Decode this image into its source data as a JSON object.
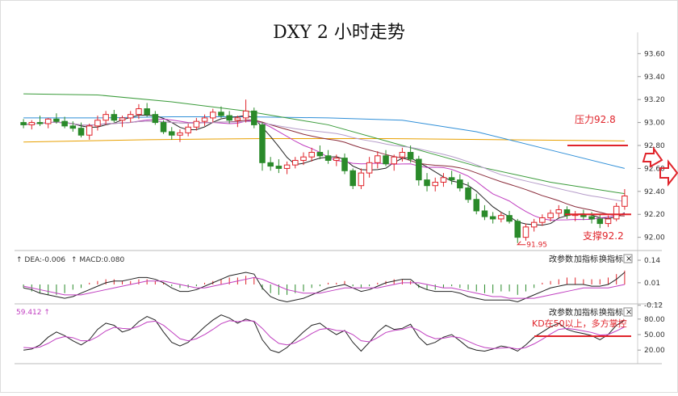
{
  "title": "DXY 2 小时走势",
  "chart_data": {
    "type": "candlestick",
    "title": "DXY 2 小时走势",
    "main": {
      "ylim": [
        91.92,
        93.68
      ],
      "yticks": [
        "93.60",
        "93.40",
        "93.20",
        "93.00",
        "92.80",
        "92.60",
        "92.40",
        "92.20",
        "92.00"
      ],
      "candles": [
        [
          93.0,
          93.03,
          92.95,
          92.98
        ],
        [
          92.98,
          93.02,
          92.94,
          93.0
        ],
        [
          93.0,
          93.06,
          92.97,
          92.99
        ],
        [
          92.99,
          93.04,
          92.95,
          93.03
        ],
        [
          93.03,
          93.08,
          92.99,
          93.01
        ],
        [
          93.01,
          93.05,
          92.95,
          92.97
        ],
        [
          92.97,
          93.01,
          92.92,
          92.95
        ],
        [
          92.95,
          93.0,
          92.87,
          92.89
        ],
        [
          92.89,
          92.99,
          92.85,
          92.97
        ],
        [
          92.97,
          93.06,
          92.93,
          93.02
        ],
        [
          93.02,
          93.1,
          92.98,
          93.07
        ],
        [
          93.07,
          93.11,
          93.0,
          93.02
        ],
        [
          93.02,
          93.06,
          92.96,
          93.04
        ],
        [
          93.04,
          93.1,
          93.0,
          93.07
        ],
        [
          93.07,
          93.16,
          93.03,
          93.12
        ],
        [
          93.12,
          93.17,
          93.05,
          93.07
        ],
        [
          93.07,
          93.1,
          92.98,
          93.0
        ],
        [
          93.0,
          93.02,
          92.9,
          92.92
        ],
        [
          92.92,
          92.96,
          92.85,
          92.89
        ],
        [
          92.89,
          92.94,
          92.83,
          92.91
        ],
        [
          92.91,
          92.99,
          92.88,
          92.96
        ],
        [
          92.96,
          93.04,
          92.93,
          93.01
        ],
        [
          93.01,
          93.07,
          92.97,
          93.04
        ],
        [
          93.04,
          93.12,
          93.0,
          93.09
        ],
        [
          93.09,
          93.14,
          93.04,
          93.06
        ],
        [
          93.06,
          93.1,
          92.99,
          93.02
        ],
        [
          93.02,
          93.06,
          92.96,
          93.04
        ],
        [
          93.04,
          93.2,
          93.0,
          93.1
        ],
        [
          93.1,
          93.13,
          92.95,
          92.98
        ],
        [
          92.98,
          93.0,
          92.58,
          92.65
        ],
        [
          92.65,
          92.7,
          92.58,
          92.62
        ],
        [
          92.62,
          92.68,
          92.56,
          92.6
        ],
        [
          92.6,
          92.66,
          92.55,
          92.63
        ],
        [
          92.63,
          92.7,
          92.6,
          92.67
        ],
        [
          92.67,
          92.74,
          92.63,
          92.7
        ],
        [
          92.7,
          92.78,
          92.66,
          92.74
        ],
        [
          92.74,
          92.8,
          92.68,
          92.71
        ],
        [
          92.71,
          92.76,
          92.64,
          92.67
        ],
        [
          92.67,
          92.72,
          92.62,
          92.69
        ],
        [
          92.69,
          92.73,
          92.55,
          92.58
        ],
        [
          92.58,
          92.6,
          92.42,
          92.45
        ],
        [
          92.45,
          92.6,
          92.42,
          92.56
        ],
        [
          92.56,
          92.7,
          92.52,
          92.65
        ],
        [
          92.65,
          92.75,
          92.6,
          92.71
        ],
        [
          92.71,
          92.76,
          92.62,
          92.64
        ],
        [
          92.64,
          92.72,
          92.58,
          92.7
        ],
        [
          92.7,
          92.78,
          92.66,
          92.74
        ],
        [
          92.74,
          92.8,
          92.65,
          92.68
        ],
        [
          92.68,
          92.71,
          92.45,
          92.5
        ],
        [
          92.5,
          92.56,
          92.4,
          92.45
        ],
        [
          92.45,
          92.52,
          92.4,
          92.48
        ],
        [
          92.48,
          92.56,
          92.44,
          92.52
        ],
        [
          92.52,
          92.58,
          92.46,
          92.5
        ],
        [
          92.5,
          92.55,
          92.4,
          92.43
        ],
        [
          92.43,
          92.48,
          92.3,
          92.33
        ],
        [
          92.33,
          92.38,
          92.2,
          92.23
        ],
        [
          92.23,
          92.28,
          92.15,
          92.18
        ],
        [
          92.18,
          92.22,
          92.12,
          92.16
        ],
        [
          92.16,
          92.22,
          92.13,
          92.19
        ],
        [
          92.19,
          92.23,
          92.12,
          92.14
        ],
        [
          92.14,
          92.16,
          91.95,
          92.0
        ],
        [
          92.0,
          92.12,
          91.97,
          92.09
        ],
        [
          92.09,
          92.16,
          92.05,
          92.13
        ],
        [
          92.13,
          92.2,
          92.1,
          92.17
        ],
        [
          92.17,
          92.24,
          92.14,
          92.21
        ],
        [
          92.21,
          92.28,
          92.17,
          92.24
        ],
        [
          92.24,
          92.27,
          92.16,
          92.19
        ],
        [
          92.19,
          92.23,
          92.14,
          92.2
        ],
        [
          92.2,
          92.24,
          92.15,
          92.18
        ],
        [
          92.18,
          92.22,
          92.12,
          92.16
        ],
        [
          92.16,
          92.2,
          92.08,
          92.12
        ],
        [
          92.12,
          92.19,
          92.09,
          92.16
        ],
        [
          92.16,
          92.3,
          92.14,
          92.27
        ],
        [
          92.27,
          92.42,
          92.24,
          92.36
        ]
      ],
      "ma_levels": {
        "orange": [
          92.72,
          92.76,
          92.8,
          92.83,
          92.85,
          92.86,
          92.86,
          92.85,
          92.84
        ],
        "blue": [
          93.04,
          93.04,
          93.05,
          93.05,
          93.04,
          93.02,
          92.92,
          92.76,
          92.6
        ],
        "green": [
          93.25,
          93.24,
          93.18,
          93.1,
          92.98,
          92.8,
          92.62,
          92.48,
          92.38
        ]
      }
    },
    "macd": {
      "label": "DEA:-0.006",
      "label2": "MACD:0.080",
      "yticks": [
        "0.14",
        "0.01",
        "-0.12"
      ],
      "histogram": [
        -0.02,
        -0.04,
        -0.05,
        -0.06,
        -0.06,
        -0.05,
        -0.03,
        -0.02,
        0.01,
        0.02,
        0.03,
        0.03,
        0.02,
        0.02,
        0.03,
        0.03,
        0.02,
        0.01,
        -0.01,
        -0.02,
        -0.02,
        -0.01,
        0.01,
        0.02,
        0.03,
        0.04,
        0.04,
        0.05,
        0.04,
        -0.03,
        -0.05,
        -0.06,
        -0.06,
        -0.05,
        -0.04,
        -0.02,
        -0.01,
        0.01,
        0.01,
        0.02,
        -0.01,
        -0.02,
        -0.01,
        0.01,
        0.02,
        0.03,
        0.03,
        0.02,
        -0.02,
        -0.03,
        -0.03,
        -0.02,
        -0.01,
        -0.02,
        -0.03,
        -0.04,
        -0.05,
        -0.05,
        -0.04,
        -0.04,
        -0.06,
        -0.04,
        -0.02,
        0.01,
        0.02,
        0.03,
        0.04,
        0.04,
        0.03,
        0.03,
        0.03,
        0.04,
        0.06,
        0.08
      ],
      "dif": [
        -0.02,
        -0.03,
        -0.05,
        -0.06,
        -0.07,
        -0.08,
        -0.07,
        -0.05,
        -0.03,
        -0.01,
        0.01,
        0.02,
        0.02,
        0.03,
        0.04,
        0.04,
        0.03,
        0.01,
        -0.02,
        -0.04,
        -0.04,
        -0.03,
        -0.01,
        0.01,
        0.03,
        0.05,
        0.06,
        0.07,
        0.06,
        -0.02,
        -0.07,
        -0.09,
        -0.1,
        -0.09,
        -0.08,
        -0.06,
        -0.04,
        -0.02,
        -0.01,
        0.0,
        -0.02,
        -0.04,
        -0.03,
        -0.01,
        0.01,
        0.02,
        0.03,
        0.03,
        -0.01,
        -0.03,
        -0.04,
        -0.04,
        -0.04,
        -0.05,
        -0.07,
        -0.08,
        -0.09,
        -0.09,
        -0.09,
        -0.09,
        -0.1,
        -0.08,
        -0.06,
        -0.04,
        -0.02,
        -0.01,
        0.0,
        0.0,
        0.0,
        -0.01,
        -0.01,
        0.0,
        0.03,
        0.07
      ],
      "dea": [
        -0.01,
        -0.02,
        -0.03,
        -0.04,
        -0.05,
        -0.06,
        -0.06,
        -0.06,
        -0.05,
        -0.04,
        -0.03,
        -0.02,
        -0.01,
        0.0,
        0.01,
        0.02,
        0.02,
        0.02,
        0.01,
        0.0,
        -0.01,
        -0.02,
        -0.02,
        -0.01,
        0.0,
        0.01,
        0.02,
        0.03,
        0.04,
        0.03,
        0.01,
        -0.01,
        -0.03,
        -0.04,
        -0.05,
        -0.05,
        -0.05,
        -0.04,
        -0.03,
        -0.02,
        -0.02,
        -0.02,
        -0.02,
        -0.02,
        -0.01,
        0.0,
        0.01,
        0.01,
        0.01,
        0.0,
        -0.01,
        -0.02,
        -0.02,
        -0.03,
        -0.04,
        -0.05,
        -0.06,
        -0.07,
        -0.07,
        -0.08,
        -0.08,
        -0.08,
        -0.08,
        -0.07,
        -0.06,
        -0.05,
        -0.04,
        -0.03,
        -0.02,
        -0.02,
        -0.02,
        -0.02,
        -0.01,
        0.0
      ]
    },
    "kdj": {
      "label": "59.412",
      "yticks": [
        "80.00",
        "50.00",
        "20.00"
      ],
      "k": [
        20,
        22,
        30,
        45,
        55,
        48,
        38,
        30,
        40,
        60,
        72,
        68,
        55,
        60,
        75,
        85,
        78,
        55,
        35,
        28,
        35,
        50,
        65,
        78,
        88,
        82,
        72,
        80,
        75,
        40,
        20,
        15,
        25,
        40,
        55,
        68,
        72,
        60,
        50,
        58,
        35,
        18,
        35,
        55,
        68,
        60,
        62,
        70,
        45,
        30,
        35,
        45,
        50,
        38,
        25,
        20,
        18,
        22,
        28,
        25,
        18,
        30,
        45,
        55,
        65,
        72,
        60,
        55,
        52,
        48,
        40,
        50,
        68,
        78
      ],
      "d": [
        25,
        24,
        26,
        33,
        42,
        46,
        44,
        38,
        38,
        46,
        57,
        64,
        62,
        61,
        66,
        74,
        76,
        68,
        55,
        42,
        38,
        42,
        50,
        60,
        71,
        77,
        75,
        77,
        76,
        62,
        45,
        33,
        30,
        34,
        42,
        52,
        60,
        62,
        58,
        57,
        50,
        38,
        36,
        44,
        54,
        58,
        60,
        65,
        58,
        48,
        42,
        43,
        46,
        44,
        37,
        30,
        25,
        23,
        24,
        25,
        22,
        25,
        32,
        41,
        51,
        60,
        62,
        60,
        57,
        54,
        49,
        50,
        57,
        65
      ]
    }
  },
  "annotations": {
    "resistance_label": "压力92.8",
    "resistance_level": 92.8,
    "support_label": "支撑92.2",
    "support_level": 92.2,
    "low_label": "91.95",
    "low_level": 91.95,
    "kd_note": "KD在50以上，多方掌控"
  },
  "buttons": {
    "change_params": "改参数",
    "add_indicator": "加指标",
    "switch_indicator": "换指标",
    "close": "×"
  },
  "colors": {
    "up": "#e0242b",
    "down": "#2a8a2a",
    "annotation": "#e0242b",
    "orange_ma": "#e8a000",
    "blue_ma": "#2f8fd8",
    "green_ma": "#3a9b3a"
  }
}
